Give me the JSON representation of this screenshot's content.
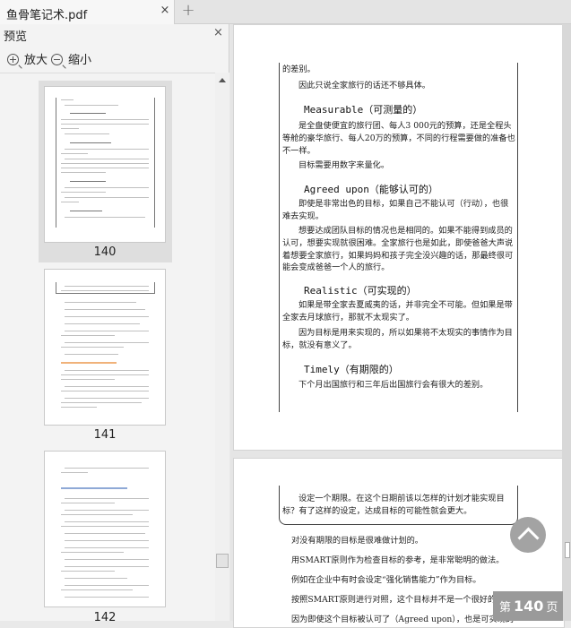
{
  "tab": {
    "title": "鱼骨笔记术.pdf",
    "close": "×",
    "new_tab": "+"
  },
  "sidebar": {
    "title": "预览",
    "close": "×",
    "zoom_in": "放大",
    "zoom_out": "缩小",
    "thumbnails": [
      {
        "label": "140",
        "selected": true
      },
      {
        "label": "141",
        "selected": false
      },
      {
        "label": "142",
        "selected": false
      }
    ],
    "thumb141_heading": "三年后年收入2 000万日元?",
    "thumb142_heading": "目标是什么？人生的目的是什么？"
  },
  "page1": {
    "lines": [
      "的差别。",
      "因此只说全家旅行的话还不够具体。",
      "是全盘使便宜的旅行团、每人3 000元的预算，还是全程头",
      "等舱的豪华旅行、每人20万的预算，不同的行程需要做的准备也",
      "不一样。",
      "目标需要用数字来量化。",
      "即使是非常出色的目标，如果自己不能认可（行动），也很",
      "难去实现。",
      "想要达成团队目标的情况也是相同的。如果不能得到成员的",
      "认可，想要实现就很困难。全家旅行也是如此，即使爸爸大声说",
      "着想要全家旅行，如果妈妈和孩子完全没兴趣的话，那最终很可",
      "能会变成爸爸一个人的旅行。",
      "如果是带全家去夏威夷的话，并非完全不可能。但如果是带",
      "全家去月球旅行，那就不太现实了。",
      "因为目标是用来实现的，所以如果将不太现实的事情作为目",
      "标，就没有意义了。",
      "下个月出国旅行和三年后出国旅行会有很大的差别。"
    ],
    "headings": [
      {
        "en": "Measurable",
        "cn": "（可测量的）"
      },
      {
        "en": "Agreed upon",
        "cn": "（能够认可的）"
      },
      {
        "en": "Realistic",
        "cn": "（可实现的）"
      },
      {
        "en": "Timely",
        "cn": "（有期限的）"
      }
    ]
  },
  "page2": {
    "lines": [
      "设定一个期限。在这个日期前该以怎样的计划才能实现目",
      "标？有了这样的设定，达成目标的可能性就会更大。",
      "对没有期限的目标是很难做计划的。",
      "用SMART原则作为检查目标的参考，是非常聪明的做法。",
      "例如在企业中有时会设定“强化销售能力”作为目标。",
      "按照SMART原则进行对照，这个目标并不是一个很好的目标。",
      "因为即使这个目标被认可了（Agreed upon），也是可实现的"
    ]
  },
  "page_badge": {
    "prefix": "第",
    "number": "140",
    "suffix": "页"
  },
  "icons": [
    "close-icon",
    "plus-icon",
    "zoom-in-icon",
    "zoom-out-icon",
    "scroll-top-icon",
    "scroll-up-arrow-icon"
  ]
}
